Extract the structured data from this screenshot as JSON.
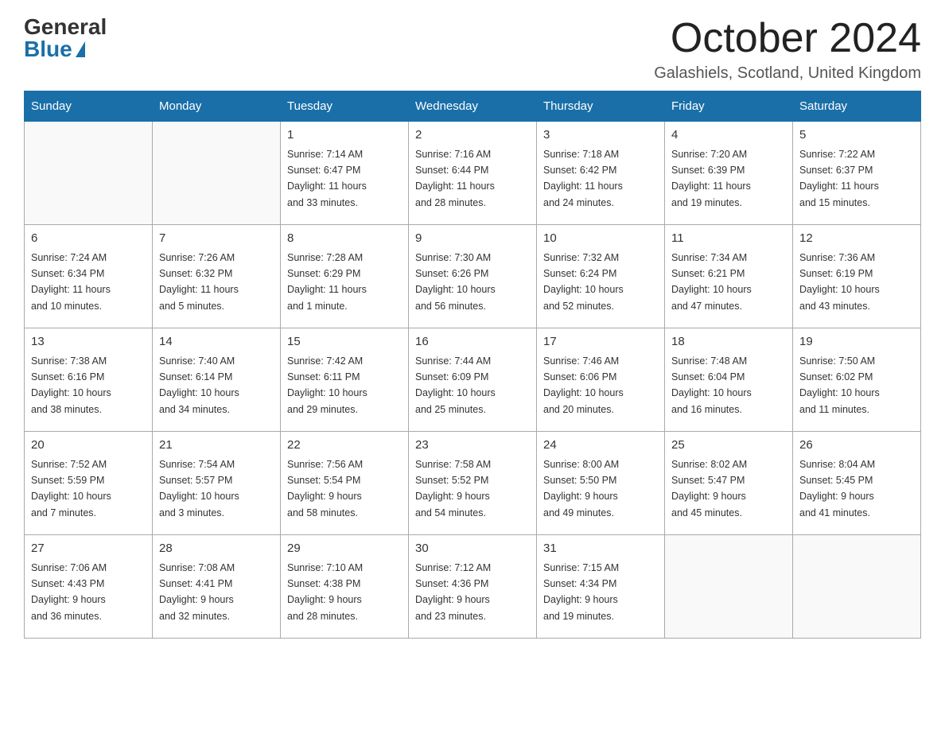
{
  "logo": {
    "general": "General",
    "blue": "Blue"
  },
  "title": "October 2024",
  "location": "Galashiels, Scotland, United Kingdom",
  "days_of_week": [
    "Sunday",
    "Monday",
    "Tuesday",
    "Wednesday",
    "Thursday",
    "Friday",
    "Saturday"
  ],
  "weeks": [
    [
      {
        "day": "",
        "info": ""
      },
      {
        "day": "",
        "info": ""
      },
      {
        "day": "1",
        "info": "Sunrise: 7:14 AM\nSunset: 6:47 PM\nDaylight: 11 hours\nand 33 minutes."
      },
      {
        "day": "2",
        "info": "Sunrise: 7:16 AM\nSunset: 6:44 PM\nDaylight: 11 hours\nand 28 minutes."
      },
      {
        "day": "3",
        "info": "Sunrise: 7:18 AM\nSunset: 6:42 PM\nDaylight: 11 hours\nand 24 minutes."
      },
      {
        "day": "4",
        "info": "Sunrise: 7:20 AM\nSunset: 6:39 PM\nDaylight: 11 hours\nand 19 minutes."
      },
      {
        "day": "5",
        "info": "Sunrise: 7:22 AM\nSunset: 6:37 PM\nDaylight: 11 hours\nand 15 minutes."
      }
    ],
    [
      {
        "day": "6",
        "info": "Sunrise: 7:24 AM\nSunset: 6:34 PM\nDaylight: 11 hours\nand 10 minutes."
      },
      {
        "day": "7",
        "info": "Sunrise: 7:26 AM\nSunset: 6:32 PM\nDaylight: 11 hours\nand 5 minutes."
      },
      {
        "day": "8",
        "info": "Sunrise: 7:28 AM\nSunset: 6:29 PM\nDaylight: 11 hours\nand 1 minute."
      },
      {
        "day": "9",
        "info": "Sunrise: 7:30 AM\nSunset: 6:26 PM\nDaylight: 10 hours\nand 56 minutes."
      },
      {
        "day": "10",
        "info": "Sunrise: 7:32 AM\nSunset: 6:24 PM\nDaylight: 10 hours\nand 52 minutes."
      },
      {
        "day": "11",
        "info": "Sunrise: 7:34 AM\nSunset: 6:21 PM\nDaylight: 10 hours\nand 47 minutes."
      },
      {
        "day": "12",
        "info": "Sunrise: 7:36 AM\nSunset: 6:19 PM\nDaylight: 10 hours\nand 43 minutes."
      }
    ],
    [
      {
        "day": "13",
        "info": "Sunrise: 7:38 AM\nSunset: 6:16 PM\nDaylight: 10 hours\nand 38 minutes."
      },
      {
        "day": "14",
        "info": "Sunrise: 7:40 AM\nSunset: 6:14 PM\nDaylight: 10 hours\nand 34 minutes."
      },
      {
        "day": "15",
        "info": "Sunrise: 7:42 AM\nSunset: 6:11 PM\nDaylight: 10 hours\nand 29 minutes."
      },
      {
        "day": "16",
        "info": "Sunrise: 7:44 AM\nSunset: 6:09 PM\nDaylight: 10 hours\nand 25 minutes."
      },
      {
        "day": "17",
        "info": "Sunrise: 7:46 AM\nSunset: 6:06 PM\nDaylight: 10 hours\nand 20 minutes."
      },
      {
        "day": "18",
        "info": "Sunrise: 7:48 AM\nSunset: 6:04 PM\nDaylight: 10 hours\nand 16 minutes."
      },
      {
        "day": "19",
        "info": "Sunrise: 7:50 AM\nSunset: 6:02 PM\nDaylight: 10 hours\nand 11 minutes."
      }
    ],
    [
      {
        "day": "20",
        "info": "Sunrise: 7:52 AM\nSunset: 5:59 PM\nDaylight: 10 hours\nand 7 minutes."
      },
      {
        "day": "21",
        "info": "Sunrise: 7:54 AM\nSunset: 5:57 PM\nDaylight: 10 hours\nand 3 minutes."
      },
      {
        "day": "22",
        "info": "Sunrise: 7:56 AM\nSunset: 5:54 PM\nDaylight: 9 hours\nand 58 minutes."
      },
      {
        "day": "23",
        "info": "Sunrise: 7:58 AM\nSunset: 5:52 PM\nDaylight: 9 hours\nand 54 minutes."
      },
      {
        "day": "24",
        "info": "Sunrise: 8:00 AM\nSunset: 5:50 PM\nDaylight: 9 hours\nand 49 minutes."
      },
      {
        "day": "25",
        "info": "Sunrise: 8:02 AM\nSunset: 5:47 PM\nDaylight: 9 hours\nand 45 minutes."
      },
      {
        "day": "26",
        "info": "Sunrise: 8:04 AM\nSunset: 5:45 PM\nDaylight: 9 hours\nand 41 minutes."
      }
    ],
    [
      {
        "day": "27",
        "info": "Sunrise: 7:06 AM\nSunset: 4:43 PM\nDaylight: 9 hours\nand 36 minutes."
      },
      {
        "day": "28",
        "info": "Sunrise: 7:08 AM\nSunset: 4:41 PM\nDaylight: 9 hours\nand 32 minutes."
      },
      {
        "day": "29",
        "info": "Sunrise: 7:10 AM\nSunset: 4:38 PM\nDaylight: 9 hours\nand 28 minutes."
      },
      {
        "day": "30",
        "info": "Sunrise: 7:12 AM\nSunset: 4:36 PM\nDaylight: 9 hours\nand 23 minutes."
      },
      {
        "day": "31",
        "info": "Sunrise: 7:15 AM\nSunset: 4:34 PM\nDaylight: 9 hours\nand 19 minutes."
      },
      {
        "day": "",
        "info": ""
      },
      {
        "day": "",
        "info": ""
      }
    ]
  ]
}
